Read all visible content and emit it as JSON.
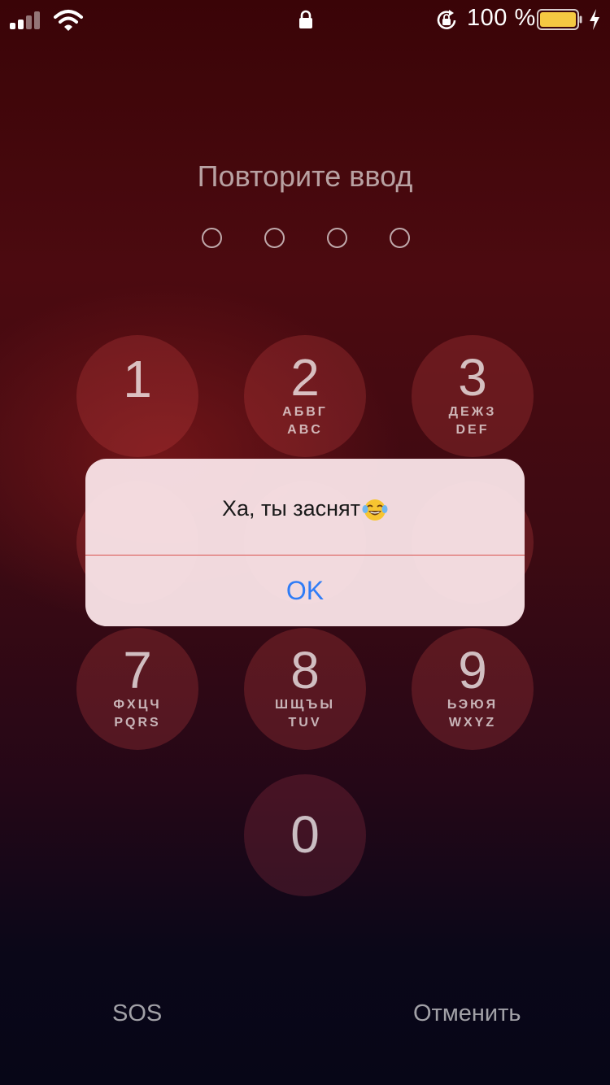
{
  "status_bar": {
    "battery_percent": "100 %",
    "icons": [
      "cellular-signal-icon",
      "wifi-icon",
      "lock-icon",
      "rotation-lock-icon",
      "battery-icon",
      "charging-bolt-icon"
    ],
    "battery_color": "#f5c842"
  },
  "passcode": {
    "prompt": "Повторите ввод",
    "digits_entered": 0,
    "digits_total": 4
  },
  "keypad": {
    "keys": [
      {
        "digit": "1",
        "letters_ru": "",
        "letters_en": ""
      },
      {
        "digit": "2",
        "letters_ru": "АБВГ",
        "letters_en": "ABC"
      },
      {
        "digit": "3",
        "letters_ru": "ДЕЖЗ",
        "letters_en": "DEF"
      },
      {
        "digit": "7",
        "letters_ru": "ФХЦЧ",
        "letters_en": "PQRS"
      },
      {
        "digit": "8",
        "letters_ru": "ШЩЪЫ",
        "letters_en": "TUV"
      },
      {
        "digit": "9",
        "letters_ru": "ЬЭЮЯ",
        "letters_en": "WXYZ"
      },
      {
        "digit": "0",
        "letters_ru": "",
        "letters_en": ""
      }
    ]
  },
  "alert": {
    "message": "Ха, ты заснят",
    "emoji": "face-with-tears-of-joy-icon",
    "ok_label": "OK",
    "ok_color": "#2f7cf6"
  },
  "footer": {
    "sos_label": "SOS",
    "cancel_label": "Отменить"
  }
}
